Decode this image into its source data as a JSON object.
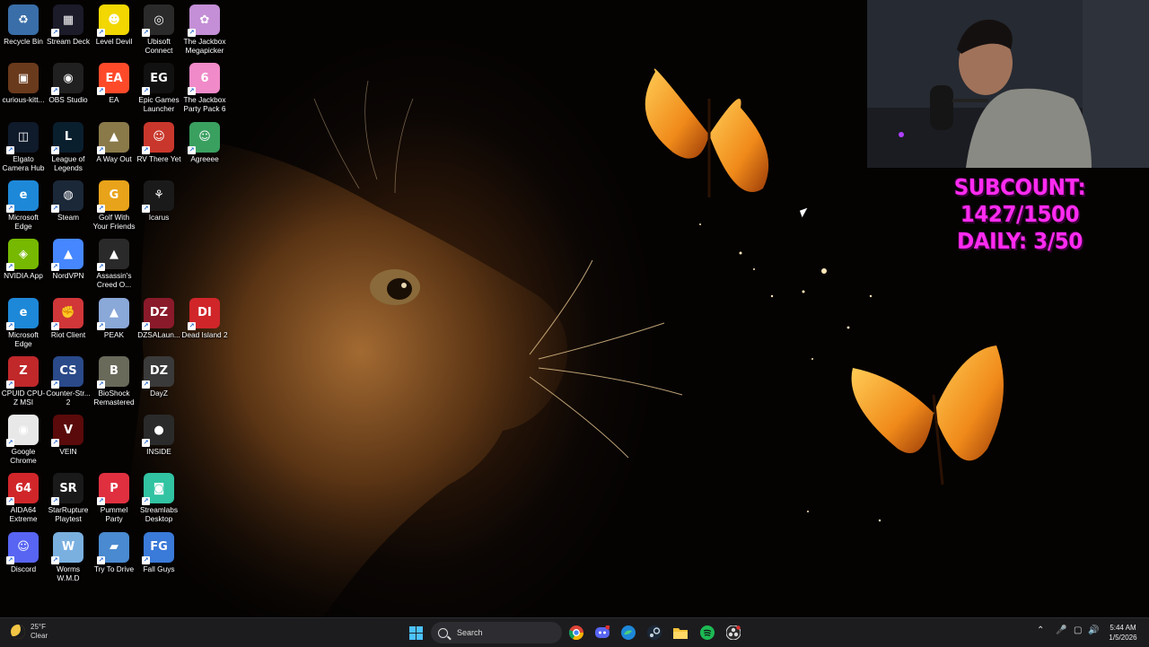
{
  "desktop": {
    "icons": [
      {
        "label": "Recycle Bin",
        "icon": "recycle-bin-icon",
        "color": "#3a6ea8"
      },
      {
        "label": "Stream Deck",
        "icon": "stream-deck-icon",
        "color": "#1b1b2a"
      },
      {
        "label": "Level Devil",
        "icon": "level-devil-icon",
        "color": "#f2d700"
      },
      {
        "label": "Ubisoft Connect",
        "icon": "ubisoft-icon",
        "color": "#2a2a2a"
      },
      {
        "label": "The Jackbox Megapicker",
        "icon": "jackbox-megapicker-icon",
        "color": "#c48fd6"
      },
      {
        "label": "curious-kitt...",
        "icon": "image-file-icon",
        "color": "#6a3a1c"
      },
      {
        "label": "OBS Studio",
        "icon": "obs-icon",
        "color": "#202020"
      },
      {
        "label": "EA",
        "icon": "ea-icon",
        "color": "#ff4a2a"
      },
      {
        "label": "Epic Games Launcher",
        "icon": "epic-games-icon",
        "color": "#111111"
      },
      {
        "label": "The Jackbox Party Pack 6",
        "icon": "jackbox-pp6-icon",
        "color": "#f08ac8"
      },
      {
        "label": "Elgato Camera Hub",
        "icon": "elgato-icon",
        "color": "#0f1a2a"
      },
      {
        "label": "League of Legends",
        "icon": "league-icon",
        "color": "#0a1f2e"
      },
      {
        "label": "A Way Out",
        "icon": "a-way-out-icon",
        "color": "#8a7a4a"
      },
      {
        "label": "RV There Yet",
        "icon": "rv-there-yet-icon",
        "color": "#c9372c"
      },
      {
        "label": "Agreeee",
        "icon": "agreeee-icon",
        "color": "#3aa060"
      },
      {
        "label": "Microsoft Edge",
        "icon": "edge-icon",
        "color": "#1e88d8"
      },
      {
        "label": "Steam",
        "icon": "steam-icon",
        "color": "#1b2838"
      },
      {
        "label": "Golf With Your Friends",
        "icon": "golf-icon",
        "color": "#e8a31a"
      },
      {
        "label": "Icarus",
        "icon": "icarus-icon",
        "color": "#1a1a1a"
      },
      {
        "label": "NVIDIA App",
        "icon": "nvidia-icon",
        "color": "#76b900"
      },
      {
        "label": "NordVPN",
        "icon": "nordvpn-icon",
        "color": "#4687ff"
      },
      {
        "label": "Assassin's Creed O...",
        "icon": "assassins-creed-icon",
        "color": "#2a2a2a"
      },
      {
        "label": "Microsoft Edge",
        "icon": "edge-icon",
        "color": "#1e88d8"
      },
      {
        "label": "Riot Client",
        "icon": "riot-client-icon",
        "color": "#d13639"
      },
      {
        "label": "PEAK",
        "icon": "peak-icon",
        "color": "#8aa8d8"
      },
      {
        "label": "DZSALaun...",
        "icon": "dzsa-launcher-icon",
        "color": "#8a1a2a"
      },
      {
        "label": "Dead Island 2",
        "icon": "dead-island-icon",
        "color": "#d0262a"
      },
      {
        "label": "CPUID CPU-Z MSI",
        "icon": "cpuz-icon",
        "color": "#c0282a"
      },
      {
        "label": "Counter-Str... 2",
        "icon": "counter-strike-icon",
        "color": "#2a4a8a"
      },
      {
        "label": "BioShock Remastered",
        "icon": "bioshock-icon",
        "color": "#6a6a5a"
      },
      {
        "label": "DayZ",
        "icon": "dayz-icon",
        "color": "#3a3a3a"
      },
      {
        "label": "Google Chrome",
        "icon": "chrome-icon",
        "color": "#e8e8e8"
      },
      {
        "label": "VEIN",
        "icon": "vein-icon",
        "color": "#5a0a0a"
      },
      {
        "label": "INSIDE",
        "icon": "inside-icon",
        "color": "#2a2a2a"
      },
      {
        "label": "AIDA64 Extreme",
        "icon": "aida64-icon",
        "color": "#d0262a"
      },
      {
        "label": "StarRupture Playtest",
        "icon": "starrupture-icon",
        "color": "#1a1a1a"
      },
      {
        "label": "Pummel Party",
        "icon": "pummel-party-icon",
        "color": "#e03040"
      },
      {
        "label": "Streamlabs Desktop",
        "icon": "streamlabs-icon",
        "color": "#31c3a2"
      },
      {
        "label": "Discord",
        "icon": "discord-icon",
        "color": "#5865f2"
      },
      {
        "label": "Worms W.M.D",
        "icon": "worms-icon",
        "color": "#7ab0e0"
      },
      {
        "label": "Try To Drive",
        "icon": "try-to-drive-icon",
        "color": "#4a8ad0"
      },
      {
        "label": "Fall Guys",
        "icon": "fall-guys-icon",
        "color": "#3a7ad8"
      }
    ]
  },
  "overlay": {
    "subcount": "SUBCOUNT: 1427/1500",
    "daily": "DAILY: 3/50"
  },
  "taskbar": {
    "weather_temp": "25°F",
    "weather_desc": "Clear",
    "search_placeholder": "Search",
    "time": "5:44 AM",
    "date": "1/5/2026",
    "apps": [
      "start-icon",
      "chrome-icon",
      "discord-icon",
      "edge-icon",
      "steam-icon",
      "file-explorer-icon",
      "spotify-icon",
      "obs-icon"
    ],
    "accent": "#0a78d7"
  }
}
